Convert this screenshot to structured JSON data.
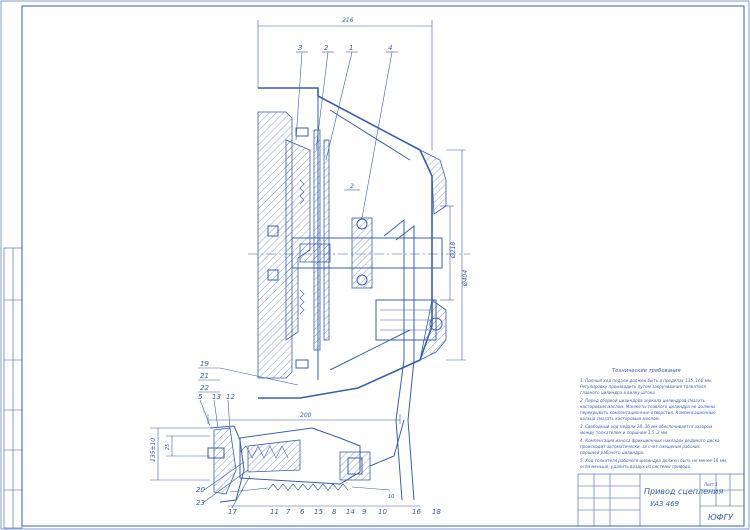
{
  "drawing": {
    "dimensions": {
      "top_width": "216",
      "diameter_inner": "Ø218",
      "diameter_outer": "Ø404",
      "pedal_length": "200",
      "pedal_stroke": "135±10",
      "pedal_small": "25",
      "pedal_free": "10",
      "gap": "2"
    },
    "callouts": {
      "c1": "1",
      "c2": "2",
      "c3": "3",
      "c4": "4",
      "c5": "5",
      "c6": "6",
      "c7": "7",
      "c8": "8",
      "c9": "9",
      "c10": "10",
      "c11": "11",
      "c12": "12",
      "c13": "13",
      "c14": "14",
      "c15": "15",
      "c16": "16",
      "c17": "17",
      "c18": "18",
      "c19": "19",
      "c20": "20",
      "c21": "21",
      "c22": "22",
      "c23": "23"
    },
    "notes": {
      "title": "Технические требования",
      "lines": [
        "1. Полный ход педали должен быть в пределах 135..160 мм.",
        "Регулировку производить путем закручивания толкателя",
        "главного цилиндра в вилку штока.",
        "2. Перед сборкой цилиндров зеркала цилиндров смазать",
        "касторовым маслом. Манжеты главного цилиндра не должны",
        "перекрывать компенсационные отверстия. Компенсационные",
        "кольца смазать касторовым маслом.",
        "3. Свободный ход педали 28..36 мм обеспечивается зазором",
        "между толкателем и поршнем 1,5..2 мм.",
        "4. Компенсация износа фрикционных накладок ведомого диска",
        "происходит автоматически, за счет смещения рабочих",
        "поршней рабочего цилиндра.",
        "5. Ход толкателя рабочего цилиндра должен быть не менее 16 мм,",
        "если меньше, удалить воздух из системы привода."
      ]
    },
    "title_block": {
      "name": "Привод сцепления",
      "model": "УАЗ 469",
      "org": "ЮФГУ",
      "sheet": "Лист 1"
    }
  }
}
